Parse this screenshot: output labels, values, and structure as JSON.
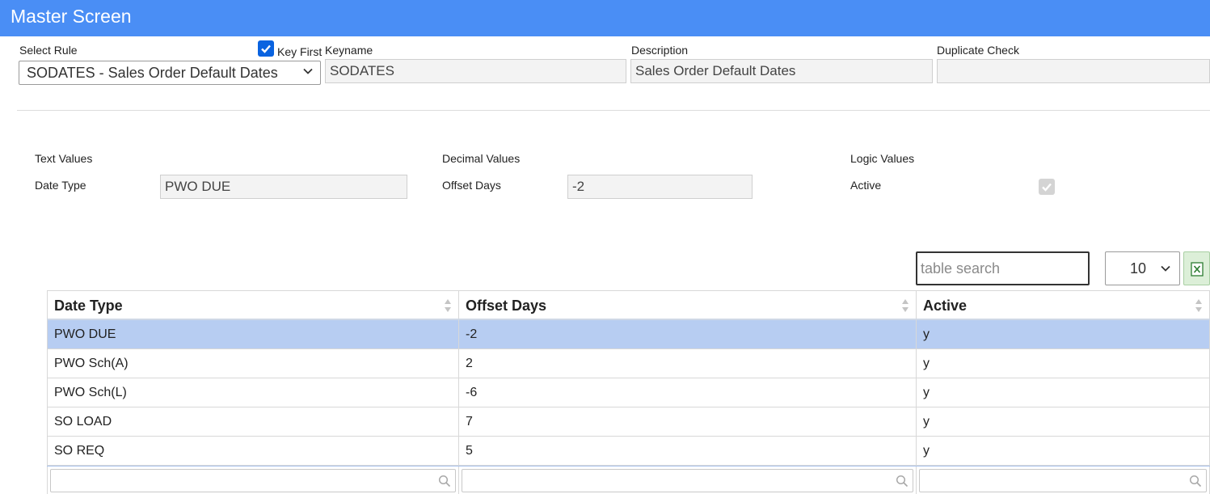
{
  "header": {
    "title": "Master Screen",
    "accent_color": "#4a8ef5"
  },
  "rule": {
    "select_label": "Select Rule",
    "selected_rule": "SODATES - Sales Order Default Dates",
    "key_first_label": "Key First",
    "key_first_checked": true,
    "keyname_label": "Keyname",
    "keyname_value": "SODATES",
    "description_label": "Description",
    "description_value": "Sales Order Default Dates",
    "duplicate_label": "Duplicate Check",
    "duplicate_value": ""
  },
  "values": {
    "text_header": "Text Values",
    "date_type_label": "Date Type",
    "date_type_value": "PWO DUE",
    "decimal_header": "Decimal Values",
    "offset_label": "Offset Days",
    "offset_value": "-2",
    "logic_header": "Logic Values",
    "active_label": "Active",
    "active_checked": true
  },
  "table": {
    "search_placeholder": "table search",
    "page_size": "10",
    "excel_icon": "excel-export-icon",
    "columns": [
      "Date Type",
      "Offset Days",
      "Active"
    ],
    "rows": [
      [
        "PWO DUE",
        "-2",
        "y"
      ],
      [
        "PWO Sch(A)",
        "2",
        "y"
      ],
      [
        "PWO Sch(L)",
        "-6",
        "y"
      ],
      [
        "SO LOAD",
        "7",
        "y"
      ],
      [
        "SO REQ",
        "5",
        "y"
      ]
    ],
    "selected_row": 0,
    "selected_color": "#b7cdf2"
  }
}
